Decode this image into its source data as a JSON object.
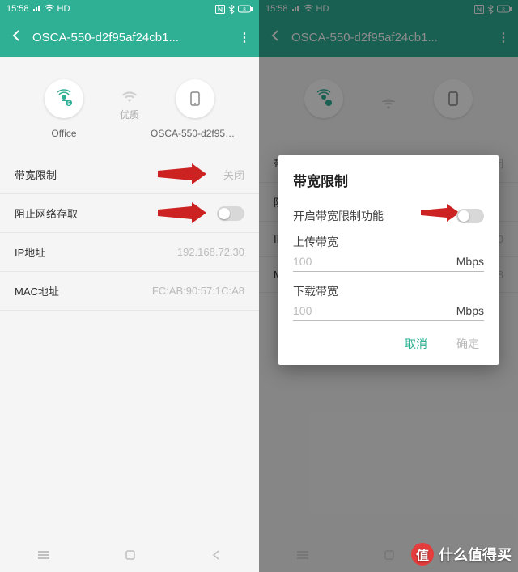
{
  "status": {
    "time": "15:58",
    "net": "HD"
  },
  "appbar": {
    "title": "OSCA-550-d2f95af24cb1..."
  },
  "devices": {
    "router": "Office",
    "quality": "优质",
    "client": "OSCA-550-d2f95af2..."
  },
  "rows": {
    "bandwidth_label": "带宽限制",
    "bandwidth_value": "关闭",
    "block_label": "阻止网络存取",
    "ip_label": "IP地址",
    "ip_value": "192.168.72.30",
    "mac_label": "MAC地址",
    "mac_value": "FC:AB:90:57:1C:A8"
  },
  "modal": {
    "title": "带宽限制",
    "enable_label": "开启带宽限制功能",
    "upload_label": "上传带宽",
    "upload_value": "100",
    "download_label": "下载带宽",
    "download_value": "100",
    "unit": "Mbps",
    "cancel": "取消",
    "ok": "确定"
  },
  "watermark": {
    "text": "什么值得买",
    "badge": "值"
  }
}
